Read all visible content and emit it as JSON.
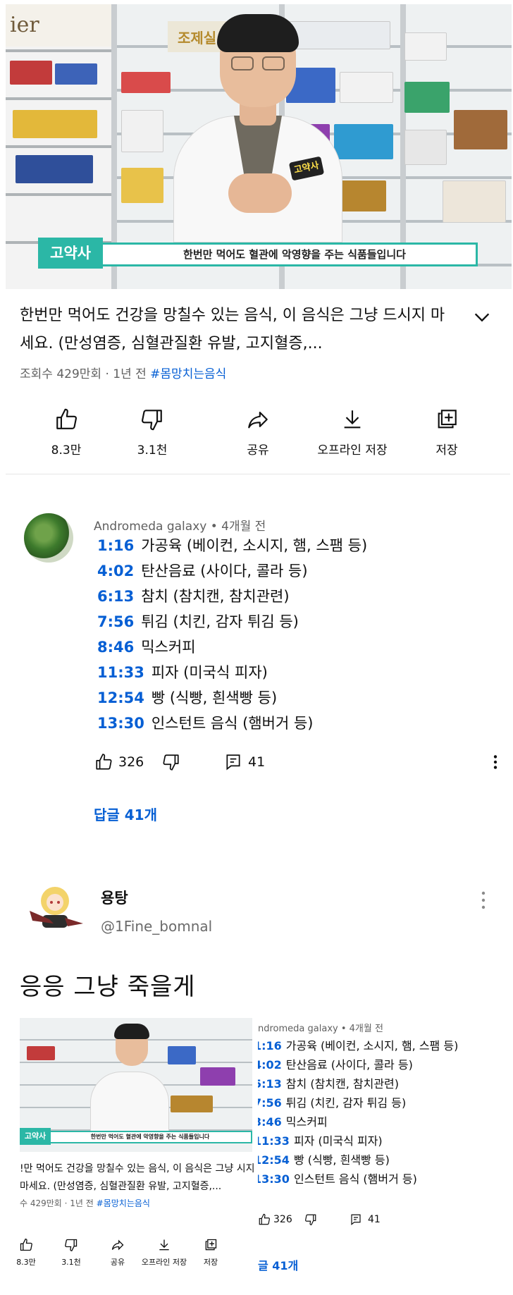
{
  "video": {
    "sign_left": "ier",
    "sign_top": "조제실",
    "badge": "고약사",
    "caption_tag": "고약사",
    "caption_text": "한번만 먹어도 혈관에 악영향을 주는 식품들입니다"
  },
  "title": "한번만 먹어도 건강을 망칠수 있는 음식, 이 음식은 그냥 드시지 마세요. (만성염증, 심혈관질환 유발, 고지혈증,...",
  "meta": {
    "views": "조회수 429만회 · 1년 전",
    "hashtag": "#몸망치는음식"
  },
  "actions": [
    {
      "icon": "thumbs-up-icon",
      "label": "8.3만"
    },
    {
      "icon": "thumbs-down-icon",
      "label": "3.1천"
    },
    {
      "icon": "share-icon",
      "label": "공유"
    },
    {
      "icon": "download-icon",
      "label": "오프라인 저장"
    },
    {
      "icon": "save-icon",
      "label": "저장"
    }
  ],
  "comment": {
    "author_line": "Andromeda galaxy • 4개월 전",
    "timestamps": [
      {
        "time": "1:16",
        "text": "가공육 (베이컨, 소시지, 햄, 스팸 등)"
      },
      {
        "time": "4:02",
        "text": "탄산음료 (사이다, 콜라 등)"
      },
      {
        "time": "6:13",
        "text": "참치 (참치캔, 참치관련)"
      },
      {
        "time": "7:56",
        "text": "튀김 (치킨, 감자 튀김 등)"
      },
      {
        "time": "8:46",
        "text": "믹스커피"
      },
      {
        "time": "11:33",
        "text": "피자 (미국식 피자)"
      },
      {
        "time": "12:54",
        "text": "빵 (식빵, 흰색빵 등)"
      },
      {
        "time": "13:30",
        "text": "인스턴트 음식 (햄버거 등)"
      }
    ],
    "likes": "326",
    "reply_count": "41",
    "replies_link": "답글 41개"
  },
  "tweet": {
    "name": "용탕",
    "handle": "@1Fine_bomnal",
    "body": "응응 그냥 죽을게"
  },
  "embed": {
    "caption_tag": "고약사",
    "caption_text": "한번만 먹어도 혈관에 악영향을 주는 식품들입니다",
    "title": "!만 먹어도 건강을 망칠수 있는 음식, 이 음식은 그냥 시지 마세요. (만성염증, 심혈관질환 유발, 고지혈증,...",
    "views": "수 429만회 · 1년 전",
    "hashtag": "#몸망치는음식",
    "actions": [
      "8.3만",
      "3.1천",
      "공유",
      "오프라인 저장",
      "저장"
    ],
    "author_line": "ndromeda galaxy • 4개월 전",
    "timestamps": [
      {
        "time": "1:16",
        "text": "가공육 (베이컨, 소시지, 햄, 스팸 등)"
      },
      {
        "time": "4:02",
        "text": "탄산음료 (사이다, 콜라 등)"
      },
      {
        "time": "5:13",
        "text": "참치 (참치캔, 참치관련)"
      },
      {
        "time": "7:56",
        "text": "튀김 (치킨, 감자 튀김 등)"
      },
      {
        "time": "3:46",
        "text": "믹스커피"
      },
      {
        "time": "11:33",
        "text": "피자 (미국식 피자)"
      },
      {
        "time": "12:54",
        "text": "빵 (식빵, 흰색빵 등)"
      },
      {
        "time": "13:30",
        "text": "인스턴트 음식 (햄버거 등)"
      }
    ],
    "likes": "326",
    "reply_count": "41",
    "replies_link": "글 41개"
  },
  "colors": {
    "link_blue": "#065fd4",
    "caption_teal": "#2bb7a6",
    "secondary_text": "#606060"
  }
}
